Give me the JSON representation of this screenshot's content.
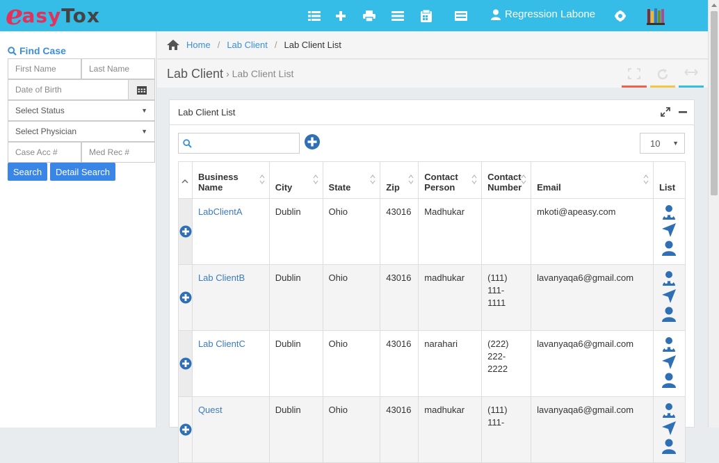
{
  "brand": {
    "letter": "e",
    "part1": "asy",
    "part2": "Tox"
  },
  "topbar": {
    "user_name": "Regression Labone"
  },
  "sidebar": {
    "find_title": "Find Case",
    "first_name_placeholder": "First Name",
    "last_name_placeholder": "Last Name",
    "dob_placeholder": "Date of Birth",
    "status_select": "Select Status",
    "physician_select": "Select Physician",
    "case_acc_placeholder": "Case Acc #",
    "med_rec_placeholder": "Med Rec #",
    "search_label": "Search",
    "detail_search_label": "Detail Search"
  },
  "breadcrumb": {
    "home": "Home",
    "level1": "Lab Client",
    "current": "Lab Client List"
  },
  "page": {
    "title": "Lab Client",
    "sub": "› Lab Client List"
  },
  "panel": {
    "title": "Lab Client List",
    "page_size": "10"
  },
  "table": {
    "headers": {
      "business_name": [
        "Business",
        "Name"
      ],
      "city": "City",
      "state": "State",
      "zip": "Zip",
      "contact_person": [
        "Contact",
        "Person"
      ],
      "contact_number": [
        "Contact",
        "Number"
      ],
      "email": "Email",
      "list": "List"
    },
    "rows": [
      {
        "name": "LabClientA",
        "city": "Dublin",
        "state": "Ohio",
        "zip": "43016",
        "person": "Madhukar",
        "number": [
          "",
          "",
          ""
        ],
        "email": "mkoti@apeasy.com"
      },
      {
        "name": "Lab ClientB",
        "city": "Dublin",
        "state": "Ohio",
        "zip": "43016",
        "person": "madhukar",
        "number": [
          "(111)",
          "111-",
          "1111"
        ],
        "email": "lavanyaqa6@gmail.com"
      },
      {
        "name": "Lab ClientC",
        "city": "Dublin",
        "state": "Ohio",
        "zip": "43016",
        "person": "narahari",
        "number": [
          "(222)",
          "222-",
          "2222"
        ],
        "email": "lavanyaqa6@gmail.com"
      },
      {
        "name": "Quest",
        "city": "Dublin",
        "state": "Ohio",
        "zip": "43016",
        "person": "madhukar",
        "number": [
          "(111)",
          "111-",
          ""
        ],
        "email": "lavanyaqa6@gmail.com"
      }
    ]
  },
  "colors": {
    "topbar": "#35bde8",
    "brand": "#e2325c",
    "link": "#3a7bc0",
    "button": "#3a86e6",
    "tool_red": "#f0604f",
    "tool_yellow": "#f4c542",
    "tool_blue": "#35bde8"
  }
}
